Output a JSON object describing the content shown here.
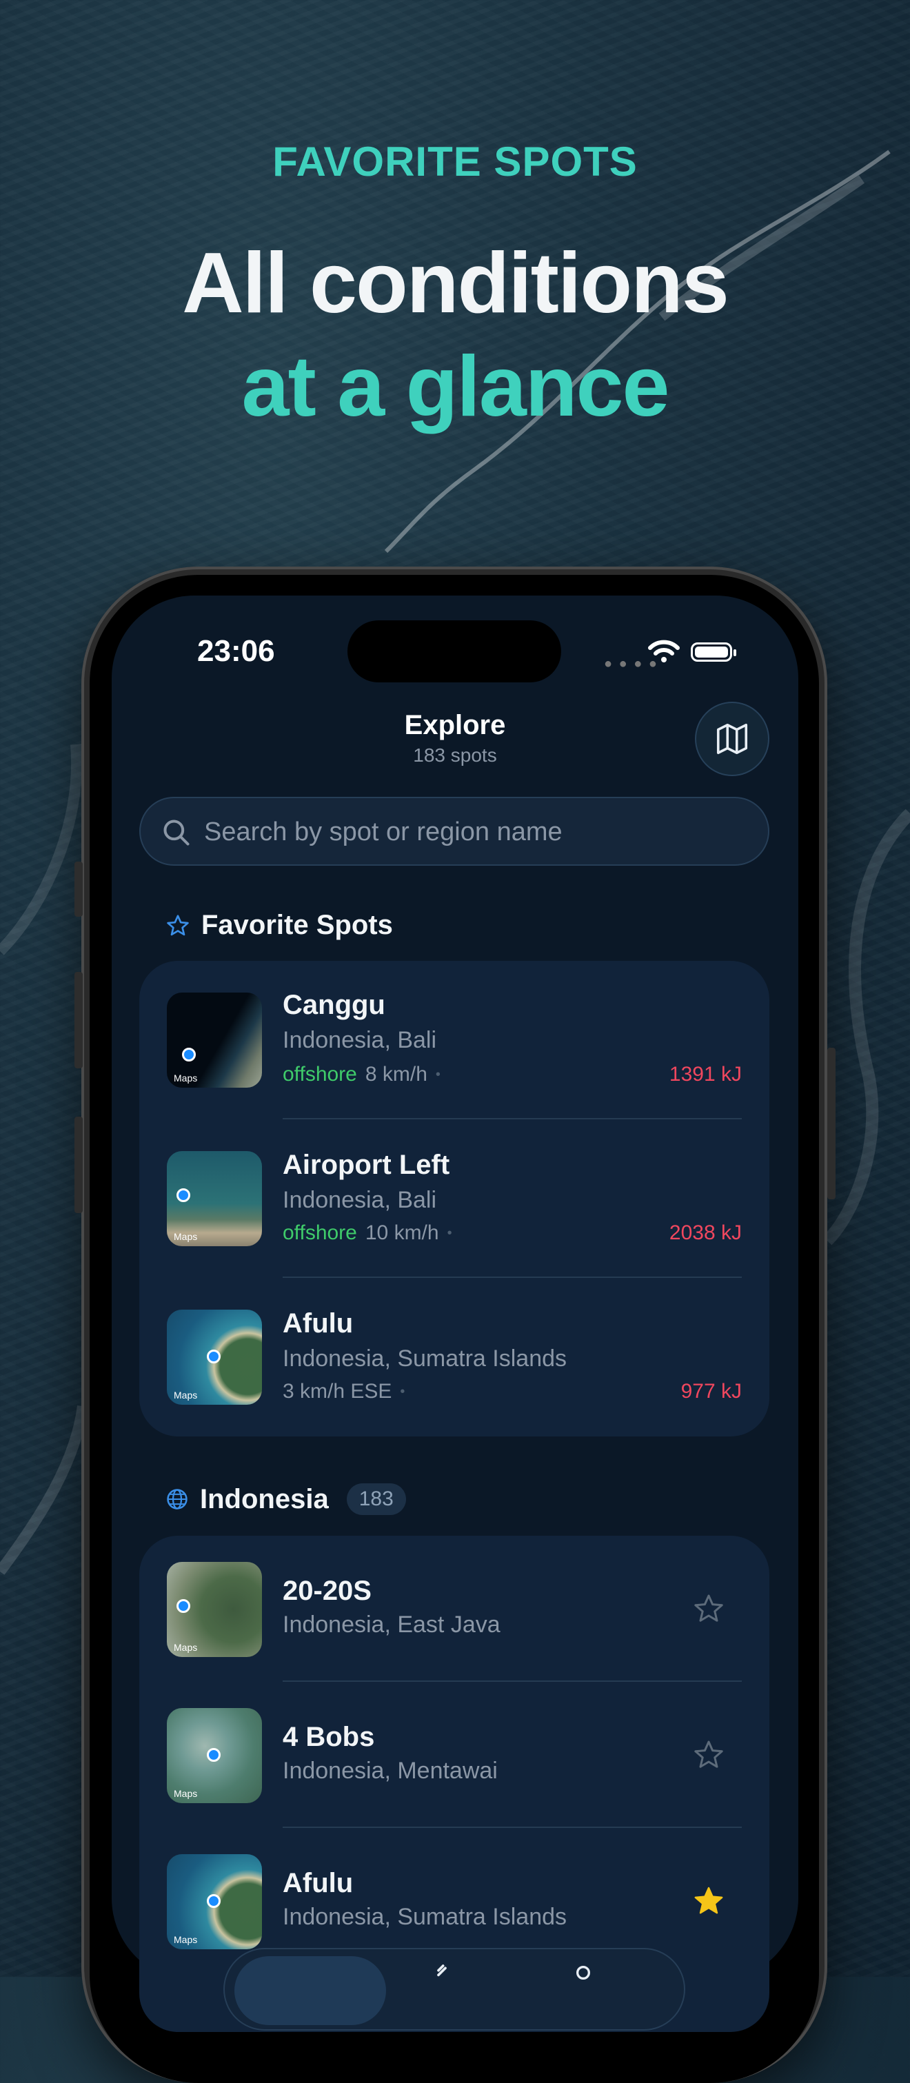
{
  "header": {
    "eyebrow": "FAVORITE SPOTS",
    "title_line1": "All conditions",
    "title_line2": "at a glance"
  },
  "status_bar": {
    "time": "23:06"
  },
  "explore": {
    "title": "Explore",
    "subtitle": "183 spots"
  },
  "search": {
    "placeholder": "Search by spot or region name"
  },
  "favorites": {
    "label": "Favorite Spots",
    "spots": [
      {
        "name": "Canggu",
        "region": "Indonesia, Bali",
        "wind_dir": "offshore",
        "wind": "8 km/h",
        "energy": "1391 kJ"
      },
      {
        "name": "Airoport Left",
        "region": "Indonesia, Bali",
        "wind_dir": "offshore",
        "wind": "10 km/h",
        "energy": "2038 kJ"
      },
      {
        "name": "Afulu",
        "region": "Indonesia, Sumatra Islands",
        "wind_dir": "",
        "wind": "3 km/h ESE",
        "energy": "977 kJ"
      }
    ]
  },
  "country": {
    "label": "Indonesia",
    "count": "183",
    "spots": [
      {
        "name": "20-20S",
        "region": "Indonesia, East Java",
        "favorite": false
      },
      {
        "name": "4 Bobs",
        "region": "Indonesia, Mentawai",
        "favorite": false
      },
      {
        "name": "Afulu",
        "region": "Indonesia, Sumatra Islands",
        "favorite": true
      }
    ]
  },
  "map_attribution": "Maps",
  "colors": {
    "accent": "#3fd1bd",
    "offshore": "#3fcb6a",
    "energy": "#f0475e",
    "star_active": "#f5c518"
  }
}
